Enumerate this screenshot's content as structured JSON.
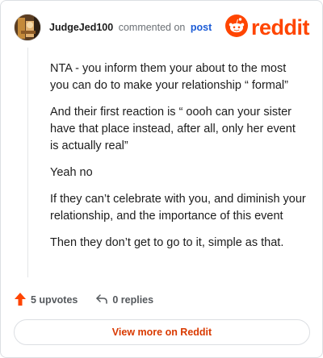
{
  "header": {
    "username": "JudgeJed100",
    "action_text": "commented on",
    "post_link": "post"
  },
  "logo": {
    "word": "reddit",
    "icon": "reddit-snoo-icon",
    "color": "#ff4500"
  },
  "comment": {
    "paragraphs": [
      "NTA - you inform them your about to the most you can do to make your relationship “ formal”",
      "And their first reaction is “ oooh can your sister have that place instead, after all, only her event is actually real”",
      "Yeah no",
      "If they can’t celebrate with you, and diminish your relationship, and the importance of this event",
      "Then they don’t get to go to it, simple as that."
    ]
  },
  "actions": {
    "upvotes": "5 upvotes",
    "upvote_icon": "upvote-arrow-icon",
    "upvote_color": "#ff4500",
    "replies": "0 replies",
    "reply_icon": "reply-arrow-icon"
  },
  "view_more": {
    "label": "View more on Reddit",
    "color": "#d93a00"
  }
}
